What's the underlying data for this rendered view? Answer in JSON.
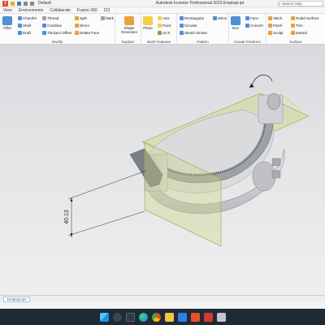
{
  "titlebar": {
    "profile": "Default",
    "title": "Autodesk Inventor Professional 2023   Emptopt.ipt",
    "search_placeholder": "Search Help"
  },
  "tabs": [
    {
      "label": "View"
    },
    {
      "label": "Environments"
    },
    {
      "label": "Collaborate"
    },
    {
      "label": "Fusion 360"
    },
    {
      "label": "CO"
    }
  ],
  "ribbon": {
    "modify": {
      "label": "Modify",
      "fillet": "Fillet",
      "chamfer": "Chamfer",
      "shell": "Shell",
      "draft": "Draft",
      "thread": "Thread",
      "combine": "Combine",
      "thicken": "Thicken/ Offset",
      "split": "Split",
      "direct": "Direct",
      "delete_face": "Delete Face",
      "mark": "Mark"
    },
    "explore": {
      "label": "Explore",
      "shape_generator": "Shape Generator"
    },
    "work_features": {
      "label": "Work Features",
      "plane": "Plane",
      "axis": "Axis",
      "point": "Point",
      "ucs": "UCS"
    },
    "pattern": {
      "label": "Pattern",
      "rectangular": "Rectangular",
      "circular": "Circular",
      "sketch_driven": "Sketch Driven",
      "mirror": "Mirror"
    },
    "freeform": {
      "label": "Create Freeform",
      "box": "Box",
      "face": "Face",
      "convert": "Convert"
    },
    "surface": {
      "label": "Surface",
      "stitch": "Stitch",
      "patch": "Patch",
      "sculpt": "Sculpt",
      "ruled_surface": "Ruled Surface",
      "trim": "Trim",
      "extend": "Extend"
    }
  },
  "viewport": {
    "dimension_value": "40.13"
  },
  "document_tab": "Emptopt.ipt",
  "colors": {
    "accent": "#1d6fbf",
    "model_body": "#d5d6d8",
    "work_plane": "#c9d77e",
    "dimension_line": "#2b2b2b"
  }
}
